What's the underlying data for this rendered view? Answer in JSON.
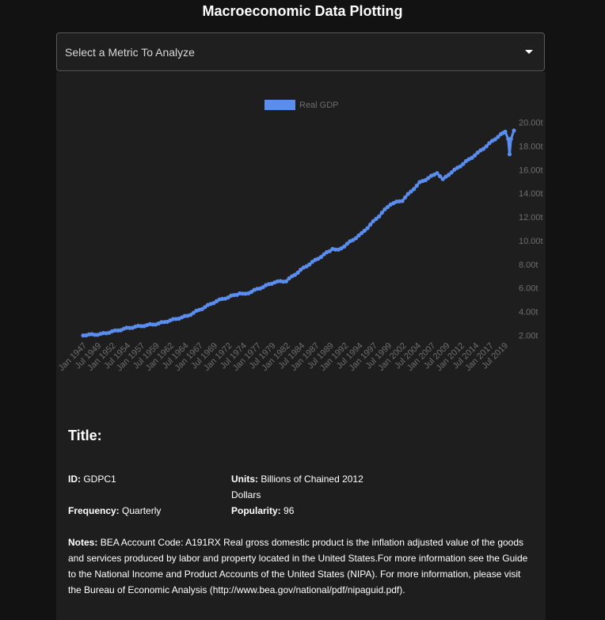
{
  "app": {
    "title": "Macroeconomic Data Plotting"
  },
  "metric_select": {
    "placeholder": "Select a Metric To Analyze"
  },
  "chart_data": {
    "type": "line",
    "title": "",
    "xlabel": "",
    "ylabel": "",
    "legend": "top",
    "grid": false,
    "colors": {
      "series": "#5b8def",
      "tick": "#6e6e6e"
    },
    "series": [
      {
        "name": "Real GDP",
        "x": [
          1947,
          1950,
          1955,
          1960,
          1965,
          1970,
          1974,
          1975,
          1980,
          1982,
          1985,
          1990,
          1991,
          1995,
          2000,
          2002,
          2005,
          2008,
          2009,
          2010,
          2015,
          2019,
          2019.75,
          2020.25,
          2020.5,
          2020.75,
          2021.25
        ],
        "y": [
          2.03,
          2.1,
          2.65,
          3.0,
          3.65,
          4.9,
          5.55,
          5.5,
          6.5,
          6.6,
          7.7,
          9.3,
          9.2,
          10.6,
          13.1,
          13.4,
          14.9,
          15.7,
          15.2,
          15.6,
          17.4,
          19.0,
          19.2,
          18.6,
          17.3,
          18.6,
          19.3
        ]
      }
    ],
    "xlim": [
      1947,
      2021.25
    ],
    "ylim": [
      1.5,
      20.5
    ],
    "x_tick_labels": [
      "Jan 1947",
      "Jul 1949",
      "Jan 1952",
      "Jul 1954",
      "Jan 1957",
      "Jul 1959",
      "Jan 1962",
      "Jul 1964",
      "Jan 1967",
      "Jul 1969",
      "Jan 1972",
      "Jul 1974",
      "Jan 1977",
      "Jul 1979",
      "Jan 1982",
      "Jul 1984",
      "Jan 1987",
      "Jul 1989",
      "Jan 1992",
      "Jul 1994",
      "Jan 1997",
      "Jul 1999",
      "Jan 2002",
      "Jul 2004",
      "Jan 2007",
      "Jul 2009",
      "Jan 2012",
      "Jul 2014",
      "Jan 2017",
      "Jul 2019"
    ],
    "y_ticks": [
      2,
      4,
      6,
      8,
      10,
      12,
      14,
      16,
      18,
      20
    ],
    "y_tick_labels": [
      "2.00t",
      "4.00t",
      "6.00t",
      "8.00t",
      "10.00t",
      "12.00t",
      "14.00t",
      "16.00t",
      "18.00t",
      "20.00t"
    ]
  },
  "info": {
    "title_label": "Title:",
    "id_label": "ID:",
    "id_value": "GDPC1",
    "units_label": "Units:",
    "units_value_line1": "Billions of Chained 2012",
    "units_value_line2": "Dollars",
    "frequency_label": "Frequency:",
    "frequency_value": "Quarterly",
    "popularity_label": "Popularity:",
    "popularity_value": "96",
    "notes_label": "Notes:",
    "notes_value": "BEA Account Code: A191RX Real gross domestic product is the inflation adjusted value of the goods and services produced by labor and property located in the United States.For more information see the Guide to the National Income and Product Accounts of the United States (NIPA). For more information, please visit the Bureau of Economic Analysis (http://www.bea.gov/national/pdf/nipaguid.pdf)."
  }
}
